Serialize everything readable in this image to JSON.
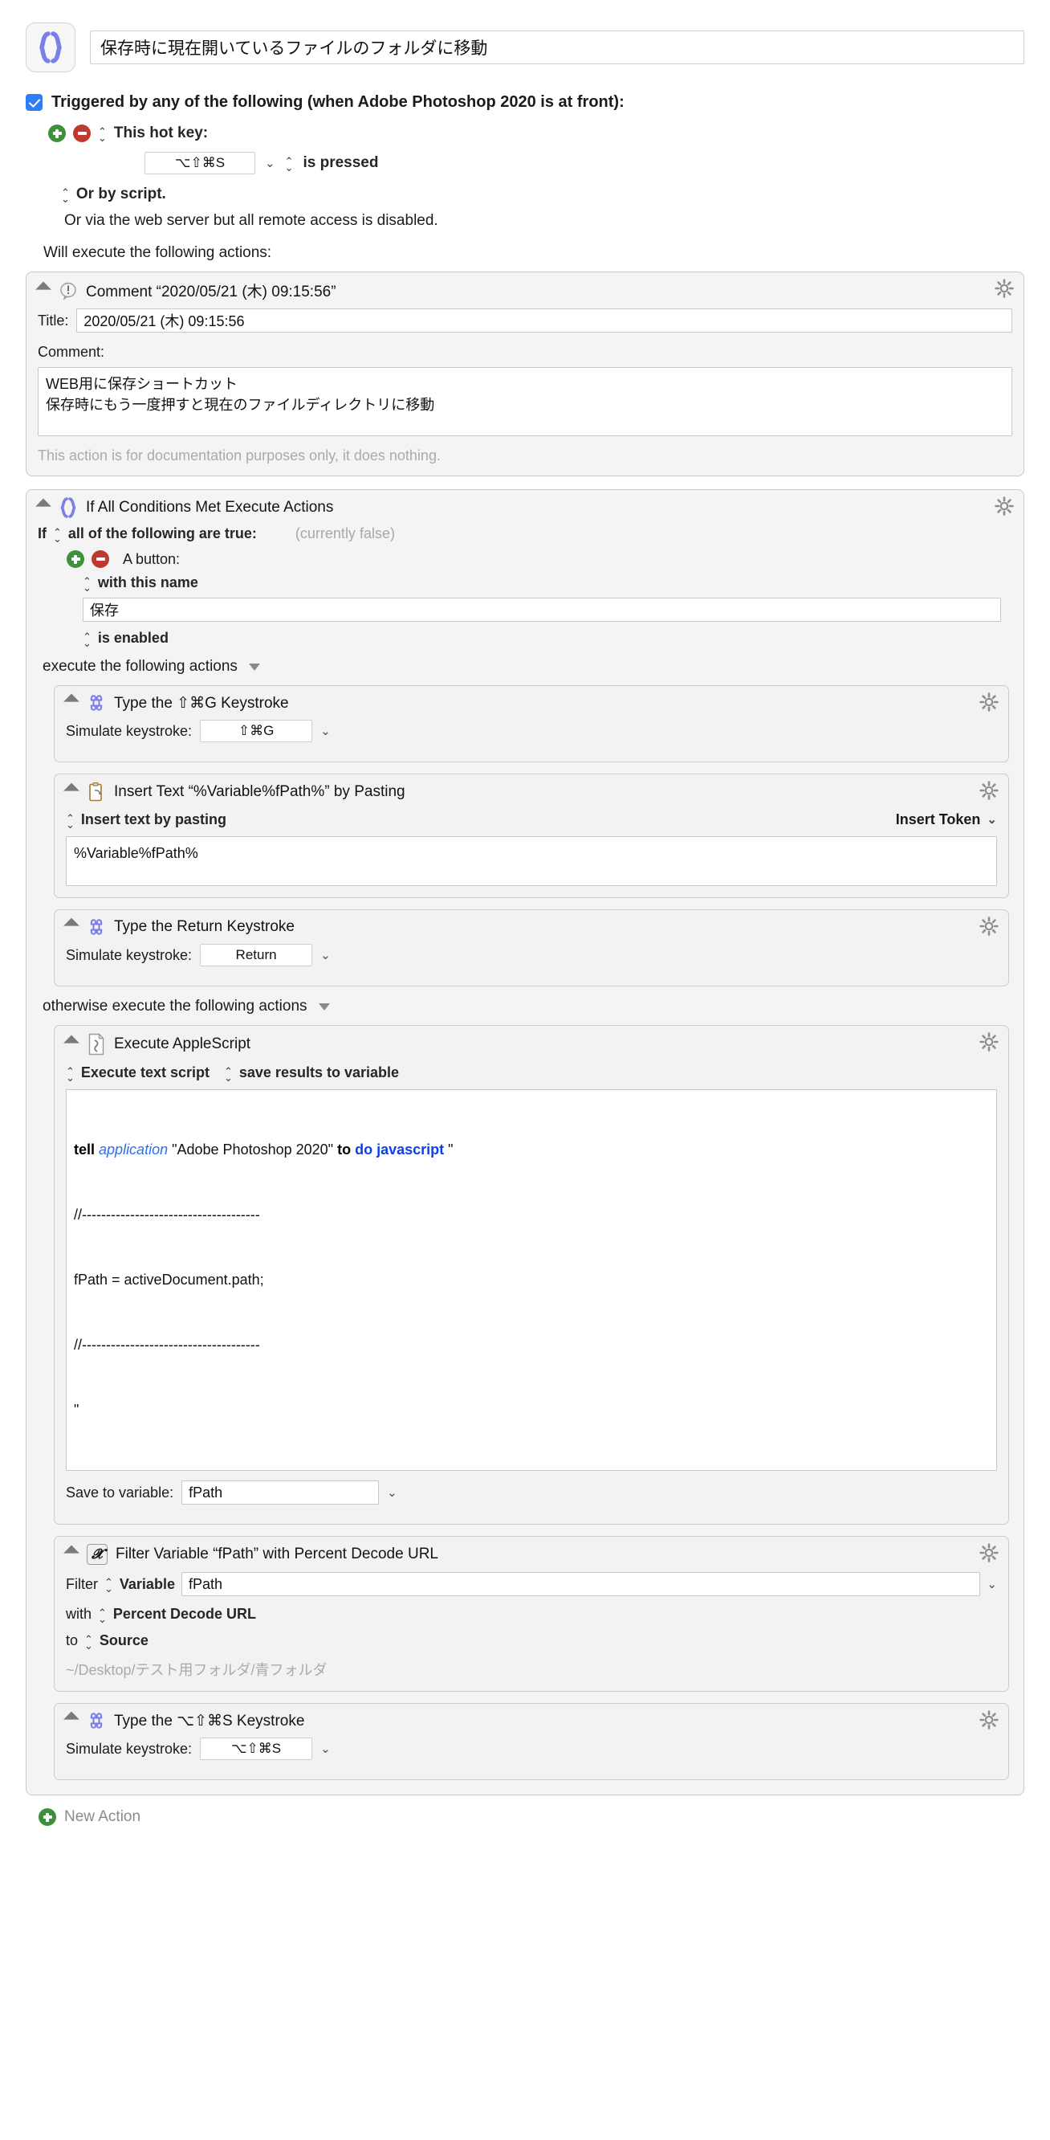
{
  "macro": {
    "icon": "braces-icon",
    "name": "保存時に現在開いているファイルのフォルダに移動"
  },
  "trigger": {
    "enabled_label": "Triggered by any of the following (when Adobe Photoshop 2020 is at front):",
    "hotkey_label": "This hot key:",
    "hotkey_value": "⌥⇧⌘S",
    "hotkey_condition": "is pressed",
    "or_by_script": "Or by script.",
    "or_web_server": "Or via the web server but all remote access is disabled.",
    "will_execute": "Will execute the following actions:"
  },
  "actions": {
    "comment": {
      "title": "Comment “2020/05/21 (木) 09:15:56”",
      "title_field_label": "Title:",
      "title_field_value": "2020/05/21 (木) 09:15:56",
      "comment_label": "Comment:",
      "comment_value": "WEB用に保存ショートカット\n保存時にもう一度押すと現在のファイルディレクトリに移動",
      "footnote": "This action is for documentation purposes only, it does nothing."
    },
    "if_block": {
      "title": "If All Conditions Met Execute Actions",
      "if_label": "If",
      "condition_mode": "all of the following are true:",
      "currently": "(currently false)",
      "condition_type": "A button:",
      "condition_match": "with this name",
      "condition_value": "保存",
      "condition_state": "is enabled",
      "then_label": "execute the following actions",
      "else_label": "otherwise execute the following actions"
    },
    "type_shift_cmd_g": {
      "title": "Type the ⇧⌘G Keystroke",
      "field_label": "Simulate keystroke:",
      "keystroke": "⇧⌘G"
    },
    "insert_text": {
      "title": "Insert Text “%Variable%fPath%” by Pasting",
      "mode": "Insert text by pasting",
      "token_button": "Insert Token",
      "value": "%Variable%fPath%"
    },
    "type_return": {
      "title": "Type the Return Keystroke",
      "field_label": "Simulate keystroke:",
      "keystroke": "Return"
    },
    "applescript": {
      "title": "Execute AppleScript",
      "mode": "Execute text script",
      "result_mode": "save results to variable",
      "code_line1_tell": "tell",
      "code_line1_application": "application",
      "code_line1_app_name": "\"Adobe Photoshop 2020\"",
      "code_line1_to": "to",
      "code_line1_do_js": "do javascript",
      "code_line1_quote": "\"",
      "code_line2": "//-------------------------------------",
      "code_line3": "fPath = activeDocument.path;",
      "code_line4": "//-------------------------------------",
      "code_line5": "\"",
      "save_label": "Save to variable:",
      "save_value": "fPath"
    },
    "filter_variable": {
      "title": "Filter Variable “fPath” with Percent Decode URL",
      "filter_label": "Filter",
      "source_type": "Variable",
      "variable_value": "fPath",
      "with_label": "with",
      "filter_type": "Percent Decode URL",
      "to_label": "to",
      "destination": "Source",
      "preview": "~/Desktop/テスト用フォルダ/青フォルダ"
    },
    "type_opt_shift_cmd_s": {
      "title": "Type the ⌥⇧⌘S Keystroke",
      "field_label": "Simulate keystroke:",
      "keystroke": "⌥⇧⌘S"
    }
  },
  "footer": {
    "new_action": "New Action"
  },
  "colors": {
    "accent_blue": "#7b7fe8",
    "checkbox_blue": "#2d7df6",
    "add_green": "#3f8f3f",
    "remove_red": "#c0392f",
    "code_keyword": "#0a3ef0"
  }
}
